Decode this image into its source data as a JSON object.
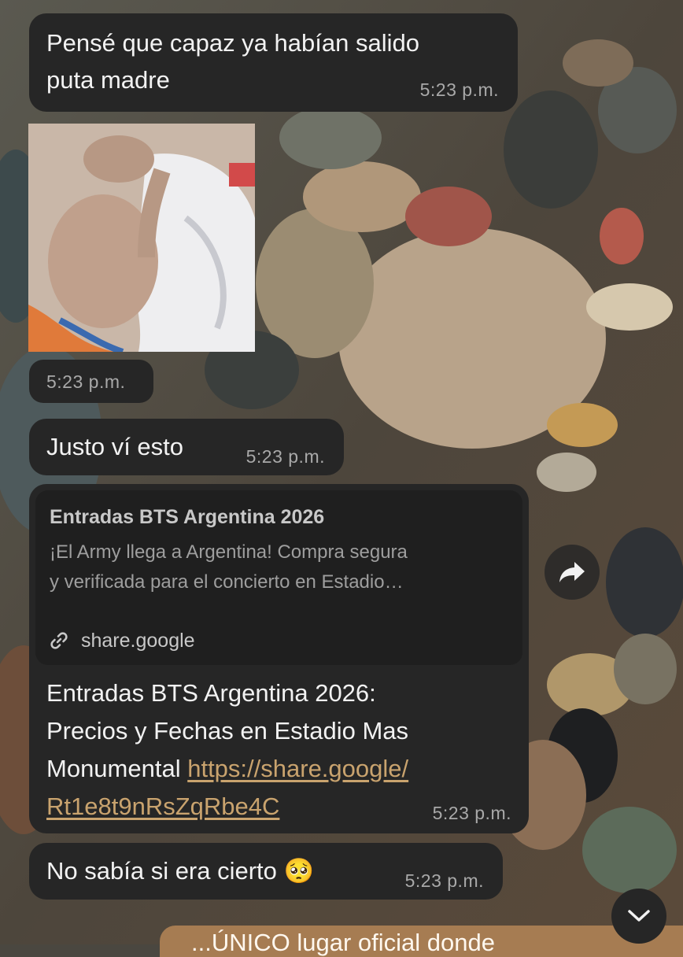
{
  "messages": [
    {
      "text_lines": [
        "Pensé que capaz ya habían salido",
        "puta madre"
      ],
      "time": "5:23 p.m."
    },
    {
      "type": "image",
      "time": "5:23 p.m."
    },
    {
      "text": "Justo ví esto",
      "time": "5:23 p.m."
    },
    {
      "preview": {
        "title": "Entradas BTS Argentina 2026",
        "description_lines": [
          "¡El Army llega a Argentina! Compra segura",
          "y verificada para el concierto en Estadio…"
        ],
        "domain": "share.google"
      },
      "body_lines": [
        "Entradas BTS Argentina 2026:",
        "Precios y Fechas en Estadio Mas"
      ],
      "body_last_prefix": "Monumental",
      "url_lines": [
        "https://share.google/",
        "Rt1e8t9nRsZqRbe4C"
      ],
      "time": "5:23 p.m."
    },
    {
      "text": "No sabía si era cierto",
      "emoji": "🥺",
      "time": "5:23 p.m."
    }
  ],
  "outgoing_partial": {
    "text": "...ÚNICO lugar oficial donde"
  },
  "colors": {
    "bubble_in": "#262626",
    "bubble_out": "#a67c52",
    "link": "#c9a36e",
    "time": "#a9a9a9"
  },
  "icons": {
    "forward": "forward-arrow-icon",
    "scroll_down": "chevron-down-icon",
    "link": "link-icon"
  }
}
